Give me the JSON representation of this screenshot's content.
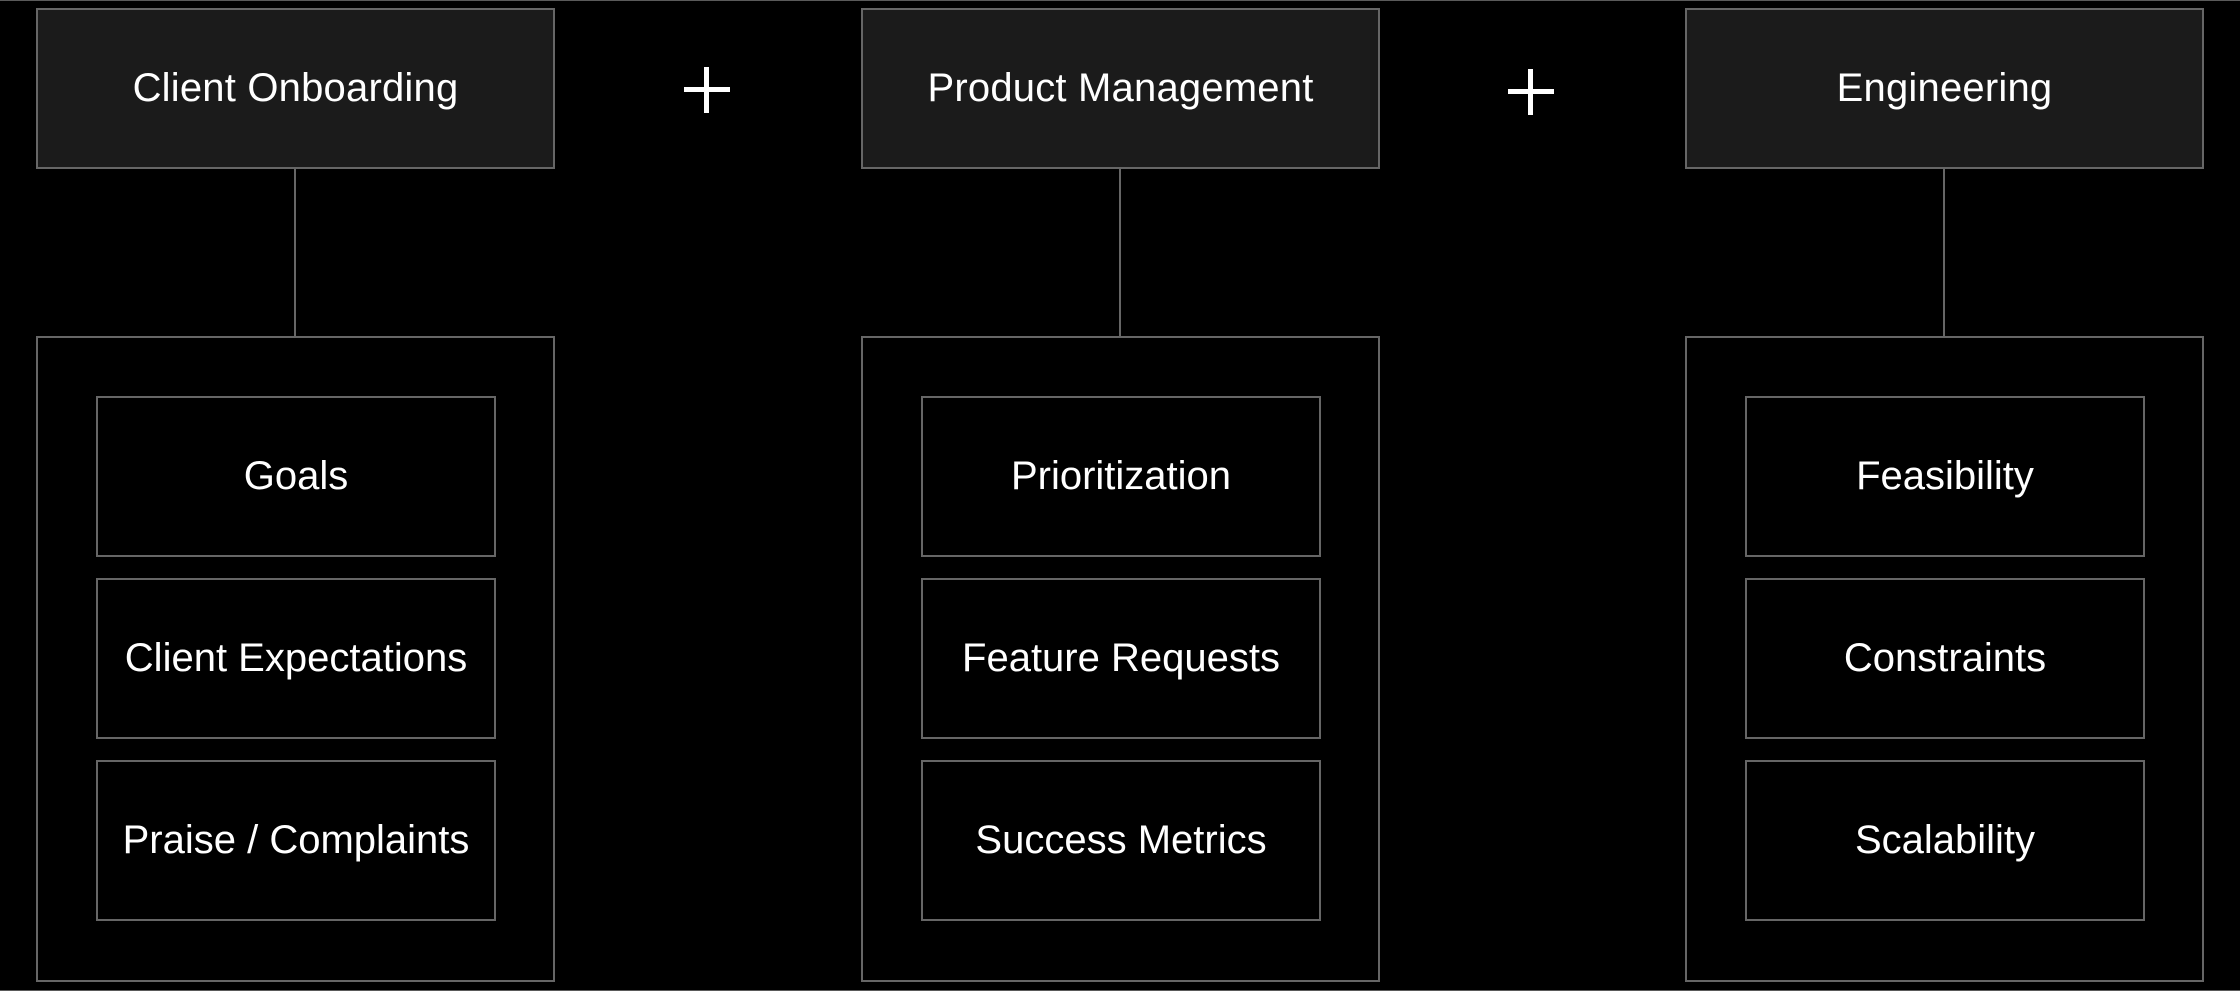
{
  "diagram": {
    "operator_symbol": "+",
    "colors": {
      "background": "#000000",
      "header_fill": "#1b1b1b",
      "border": "#666666",
      "text": "#ffffff"
    },
    "columns": [
      {
        "title": "Client Onboarding",
        "items": [
          "Goals",
          "Client Expectations",
          "Praise / Complaints"
        ]
      },
      {
        "title": "Product Management",
        "items": [
          "Prioritization",
          "Feature Requests",
          "Success Metrics"
        ]
      },
      {
        "title": "Engineering",
        "items": [
          "Feasibility",
          "Constraints",
          "Scalability"
        ]
      }
    ]
  }
}
